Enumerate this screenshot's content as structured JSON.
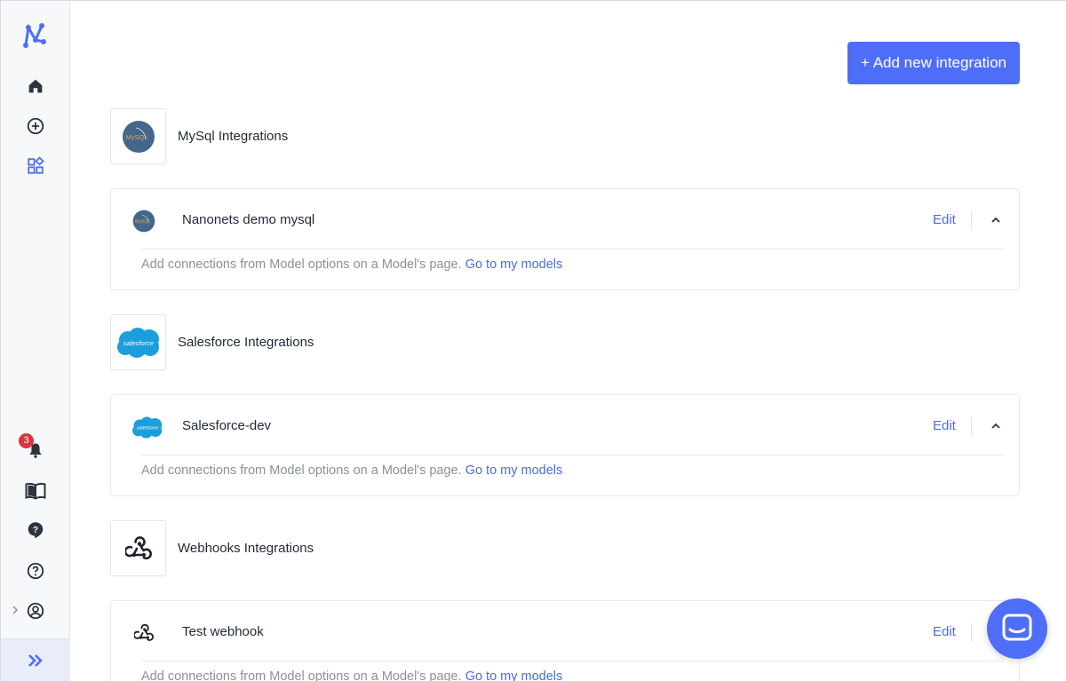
{
  "sidebar": {
    "notification_count": "3",
    "icons": [
      "nanonets-logo-icon",
      "home-icon",
      "add-circle-icon",
      "apps-grid-icon",
      "bell-icon",
      "book-icon",
      "help-bubble-icon",
      "question-circle-icon",
      "account-circle-icon",
      "double-chevron-right-icon"
    ]
  },
  "main": {
    "add_button_label": "+ Add new integration",
    "groups": [
      {
        "title": "MySql Integrations",
        "card": {
          "name": "Nanonets demo mysql",
          "edit_label": "Edit",
          "note": "Add connections from Model options on a Model's page.",
          "link": "Go to my models"
        }
      },
      {
        "title": "Salesforce Integrations",
        "card": {
          "name": "Salesforce-dev",
          "edit_label": "Edit",
          "note": "Add connections from Model options on a Model's page.",
          "link": "Go to my models"
        }
      },
      {
        "title": "Webhooks Integrations",
        "card": {
          "name": "Test webhook",
          "edit_label": "Edit",
          "note": "Add connections from Model options on a Model's page.",
          "link": "Go to my models"
        }
      }
    ],
    "logo_text": {
      "mysql": "MySQL",
      "salesforce": "salesforce"
    }
  },
  "colors": {
    "accent": "#4f6ef7",
    "link": "#4b6cd8",
    "badge": "#d9343f"
  }
}
